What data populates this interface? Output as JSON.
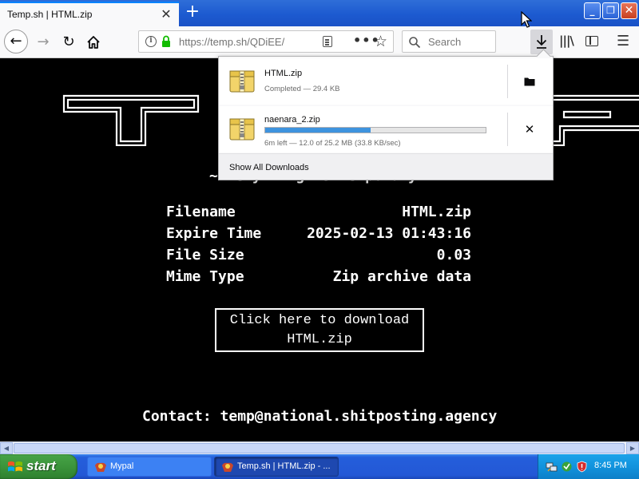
{
  "browser": {
    "tab_title": "Temp.sh | HTML.zip",
    "url": "https://temp.sh/QDiEE/",
    "search_placeholder": "Search"
  },
  "page": {
    "banner_text": "TEMP.SH",
    "tagline": "~Everything is temporary",
    "file_info": [
      {
        "label": "Filename",
        "value": "HTML.zip"
      },
      {
        "label": "Expire Time",
        "value": "2025-02-13 01:43:16"
      },
      {
        "label": "File Size",
        "value": "0.03"
      },
      {
        "label": "Mime Type",
        "value": "Zip archive data"
      }
    ],
    "download_button": {
      "line1": "Click here to download",
      "line2": "HTML.zip"
    },
    "contact": "Contact: temp@national.shitposting.agency"
  },
  "downloads_panel": {
    "items": [
      {
        "name": "HTML.zip",
        "status": "Completed — 29.4 KB",
        "action_icon": "folder-icon"
      },
      {
        "name": "naenara_2.zip",
        "status": "6m left — 12.0 of 25.2 MB (33.8 KB/sec)",
        "progress": 0.48,
        "action_icon": "cancel-icon",
        "action_glyph": "✕"
      }
    ],
    "show_all_label": "Show All Downloads"
  },
  "taskbar": {
    "start_label": "start",
    "tasks": [
      {
        "label": "Mypal"
      },
      {
        "label": "Temp.sh | HTML.zip - ..."
      }
    ],
    "clock": "8:45 PM"
  },
  "colors": {
    "accent": "#0a84ff",
    "progress": "#3e93de",
    "taskbar": "#245edb",
    "start": "#3b943b"
  }
}
